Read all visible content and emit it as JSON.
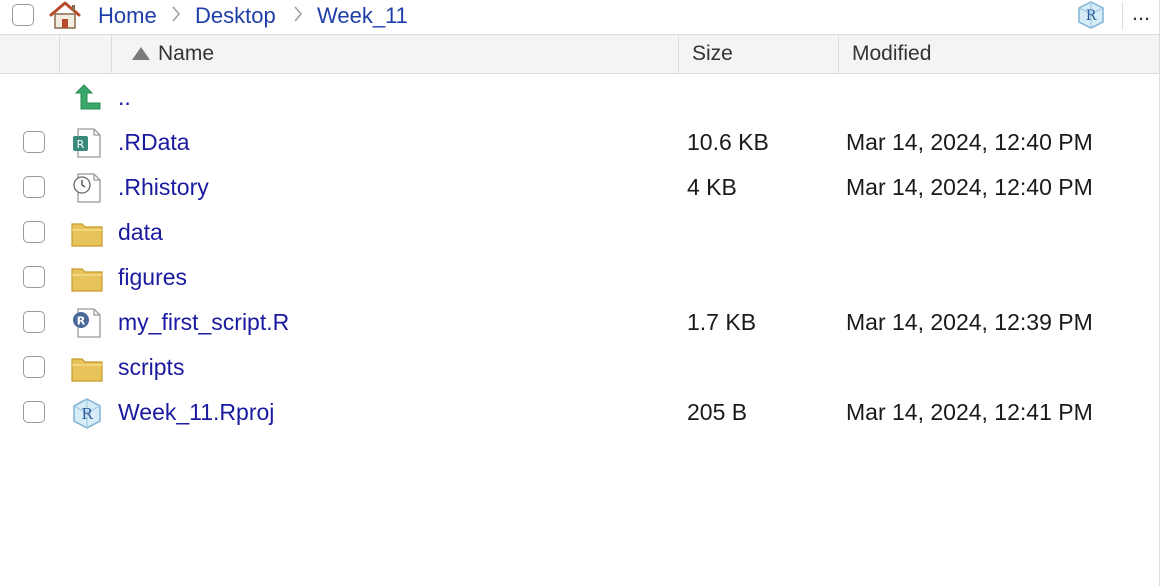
{
  "breadcrumb": {
    "items": [
      {
        "label": "Home"
      },
      {
        "label": "Desktop"
      },
      {
        "label": "Week_11"
      }
    ],
    "separator": ">",
    "more_label": "..."
  },
  "columns": {
    "name": "Name",
    "size": "Size",
    "modified": "Modified",
    "sort": "ascending"
  },
  "files": [
    {
      "name": "..",
      "size": "",
      "modified": "",
      "icon": "up-arrow-icon",
      "checkbox": false
    },
    {
      "name": ".RData",
      "size": "10.6 KB",
      "modified": "Mar 14, 2024, 12:40 PM",
      "icon": "rdata-file-icon",
      "checkbox": true
    },
    {
      "name": ".Rhistory",
      "size": "4 KB",
      "modified": "Mar 14, 2024, 12:40 PM",
      "icon": "history-file-icon",
      "checkbox": true
    },
    {
      "name": "data",
      "size": "",
      "modified": "",
      "icon": "folder-icon",
      "checkbox": true
    },
    {
      "name": "figures",
      "size": "",
      "modified": "",
      "icon": "folder-icon",
      "checkbox": true
    },
    {
      "name": "my_first_script.R",
      "size": "1.7 KB",
      "modified": "Mar 14, 2024, 12:39 PM",
      "icon": "r-script-icon",
      "checkbox": true
    },
    {
      "name": "scripts",
      "size": "",
      "modified": "",
      "icon": "folder-icon",
      "checkbox": true
    },
    {
      "name": "Week_11.Rproj",
      "size": "205 B",
      "modified": "Mar 14, 2024, 12:41 PM",
      "icon": "rproj-file-icon",
      "checkbox": true
    }
  ],
  "colors": {
    "link": "#1a1aa0",
    "breadcrumb": "#1f3fa8",
    "header_bg": "#f4f4f4",
    "folder": "#e8c35a"
  }
}
